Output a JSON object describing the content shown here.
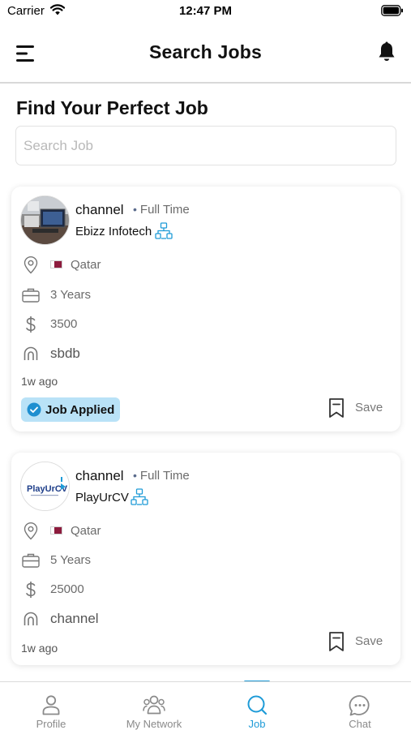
{
  "status_bar": {
    "carrier": "Carrier",
    "time": "12:47 PM"
  },
  "header": {
    "title": "Search Jobs"
  },
  "section": {
    "title": "Find Your Perfect Job"
  },
  "search": {
    "placeholder": "Search Job",
    "value": ""
  },
  "jobs": [
    {
      "title": "channel",
      "type": "Full Time",
      "company": "Ebizz Infotech",
      "location": "Qatar",
      "experience": "3 Years",
      "salary": "3500",
      "skill": "sbdb",
      "posted": "1w ago",
      "applied_label": "Job Applied",
      "save_label": "Save"
    },
    {
      "title": "channel",
      "type": "Full Time",
      "company": "PlayUrCV",
      "logo_text": "PlayUrCV",
      "location": "Qatar",
      "experience": "5 Years",
      "salary": "25000",
      "skill": "channel",
      "posted": "1w ago",
      "save_label": "Save"
    }
  ],
  "tabs": [
    {
      "label": "Profile",
      "icon": "person-icon"
    },
    {
      "label": "My Network",
      "icon": "network-icon"
    },
    {
      "label": "Job",
      "icon": "search-icon",
      "active": true
    },
    {
      "label": "Chat",
      "icon": "chat-bubble-icon"
    }
  ],
  "colors": {
    "accent": "#1e9bd7",
    "applied_badge": "#b9e2f7",
    "qatar_maroon": "#8d1b3d"
  }
}
